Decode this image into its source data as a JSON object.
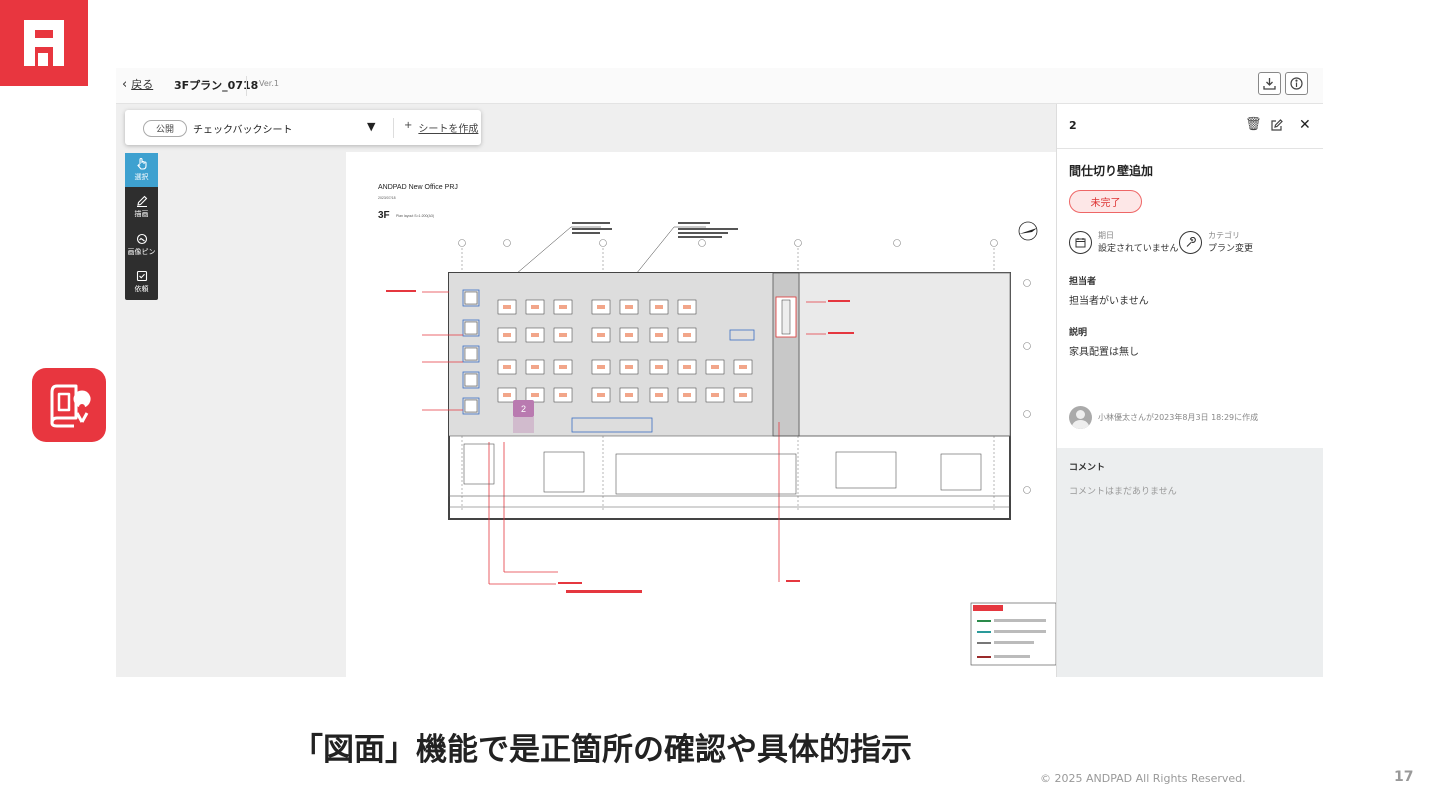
{
  "toolbar": {
    "back_label": "戻る",
    "file_name": "3Fプラン_0718",
    "version": "Ver.1",
    "download_icon": "download-icon",
    "info_icon": "info-icon"
  },
  "sheet_bar": {
    "visibility": "公開",
    "sheet_name": "チェックバックシート",
    "create_label": "シートを作成"
  },
  "tools": [
    {
      "label": "選択",
      "icon": "pointer-icon",
      "active": true
    },
    {
      "label": "描画",
      "icon": "pencil-icon",
      "active": false
    },
    {
      "label": "画像ピン",
      "icon": "image-pin-icon",
      "active": false
    },
    {
      "label": "依頼",
      "icon": "request-icon",
      "active": false
    }
  ],
  "drawing": {
    "project_title": "ANDPAD New Office PRJ",
    "date": "2023/07/18",
    "floor": "3F",
    "floor_sub": "Plan layout S=1:200(A3)",
    "pin_number": "2"
  },
  "detail_panel": {
    "number": "2",
    "title": "間仕切り壁追加",
    "status": "未完了",
    "due_label": "期日",
    "due_value": "設定されていません",
    "category_label": "カテゴリ",
    "category_value": "プラン変更",
    "assignee_label": "担当者",
    "assignee_value": "担当者がいません",
    "description_label": "説明",
    "description_value": "家具配置は無し",
    "created_by": "小林優太さんが2023年8月3日 18:29に作成",
    "comments_label": "コメント",
    "comments_empty": "コメントはまだありません"
  },
  "slide": {
    "caption": "「図面」機能で是正箇所の確認や具体的指示",
    "copyright": "© 2025 ANDPAD All Rights Reserved.",
    "page_number": "17"
  },
  "colors": {
    "brand": "#e8363f",
    "tool_active": "#3ea1d0",
    "status_red": "#d33333",
    "pin": "#b97ab0"
  }
}
